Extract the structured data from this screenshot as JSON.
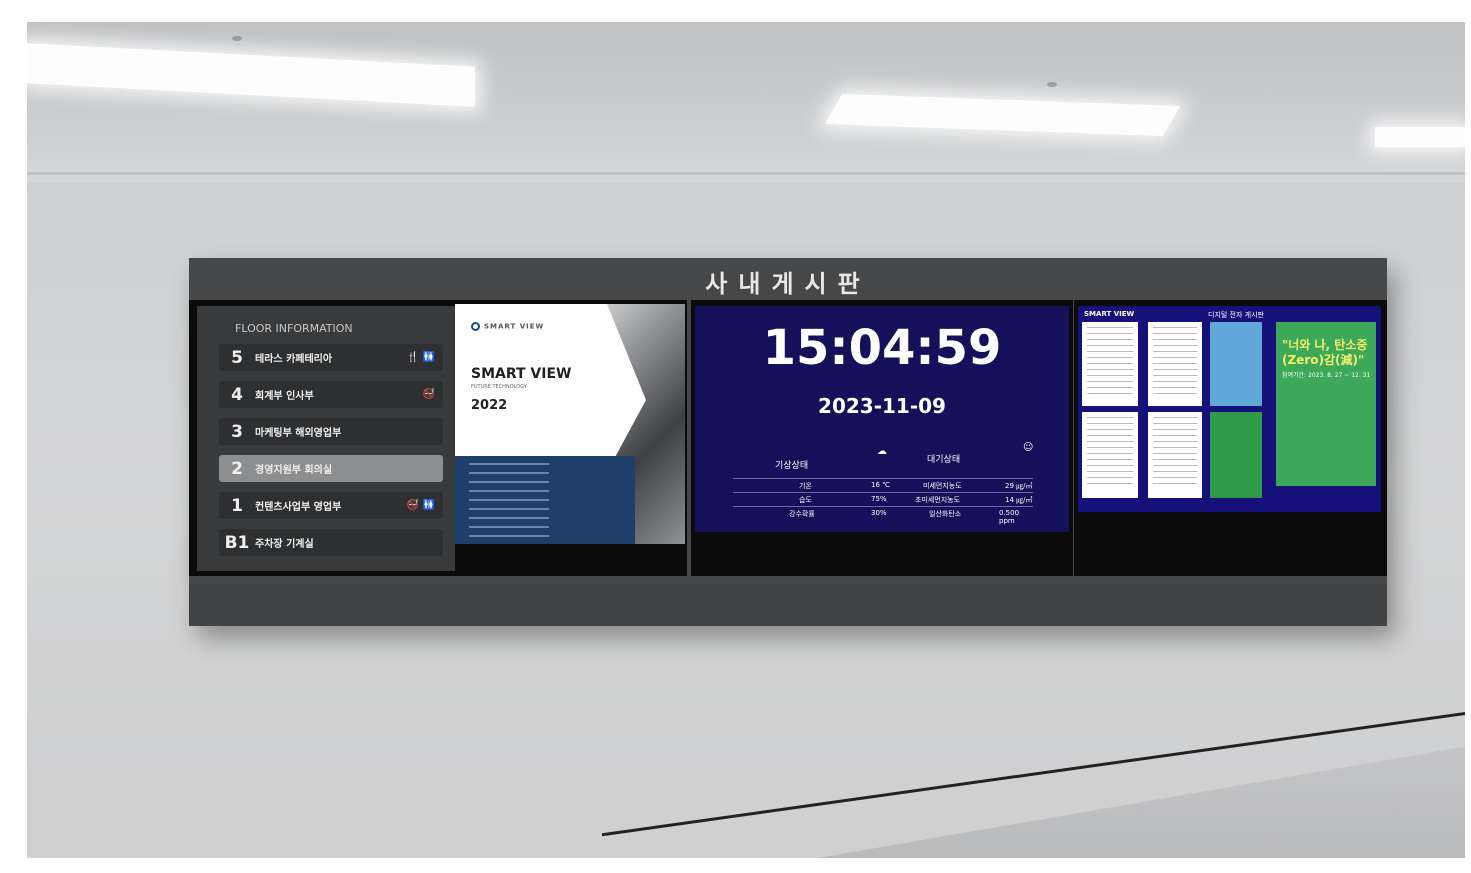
{
  "board": {
    "title": "사내게시판"
  },
  "floor_info": {
    "heading": "FLOOR INFORMATION",
    "floors": [
      {
        "num": "5",
        "label": "테라스 카페테리아",
        "icon": "🍴 🚻"
      },
      {
        "num": "4",
        "label": "회계부 인사부",
        "icon": "🚭"
      },
      {
        "num": "3",
        "label": "마케팅부 해외영업부",
        "icon": ""
      },
      {
        "num": "2",
        "label": "경영지원부 회의실",
        "icon": ""
      },
      {
        "num": "1",
        "label": "컨텐츠사업부 영업부",
        "icon": "🚭 🚻"
      },
      {
        "num": "B1",
        "label": "주차장 기계실",
        "icon": ""
      }
    ],
    "active_floor": "2"
  },
  "brochure": {
    "logo": "SMART VIEW",
    "title": "SMART VIEW",
    "subtitle": "FUTURE TECHNOLOGY",
    "year": "2022"
  },
  "clock": {
    "time": "15:04:59",
    "date": "2023-11-09"
  },
  "weather": {
    "heading": "기상상태",
    "rows": [
      {
        "label": "기온",
        "value": "16 ℃"
      },
      {
        "label": "습도",
        "value": "75%"
      },
      {
        "label": "강수확률",
        "value": "30%"
      }
    ]
  },
  "air": {
    "heading": "대기상태",
    "rows": [
      {
        "label": "미세먼지농도",
        "value": "29 ㎍/㎥"
      },
      {
        "label": "초미세먼지농도",
        "value": "14 ㎍/㎥"
      },
      {
        "label": "일산화탄소",
        "value": "0.500 ppm"
      }
    ]
  },
  "notice": {
    "logo": "SMART VIEW",
    "heading": "디지털 전자 게시판",
    "poster_title": "\"너와 나, 탄소중(Zero)감(減)\"",
    "poster_line": "참여기간: 2023. 8. 27 ~ 12. 31"
  }
}
